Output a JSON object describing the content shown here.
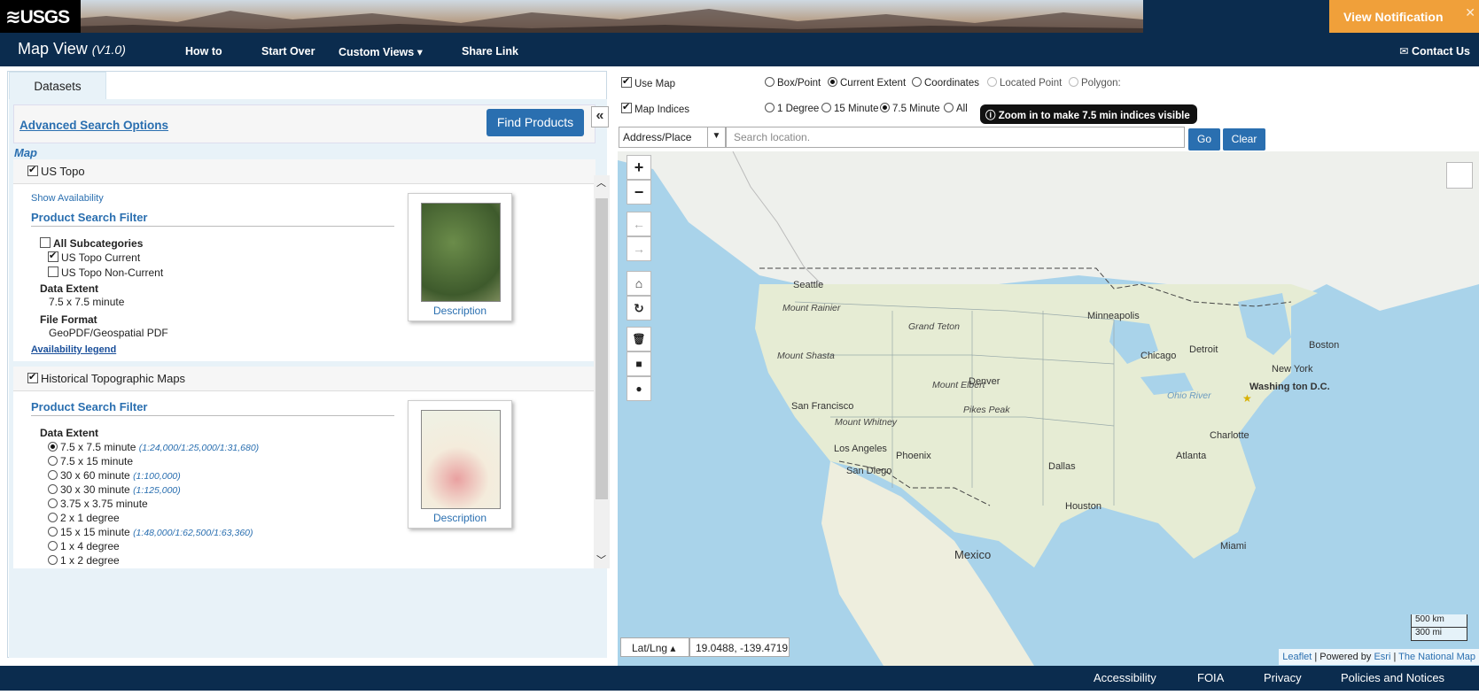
{
  "header": {
    "logo": "≋USGS",
    "notification": "View Notification",
    "close": "✕"
  },
  "nav": {
    "app_title": "Map View",
    "version": "(V1.0)",
    "how_to": "How to",
    "start_over": "Start Over",
    "custom_views": "Custom Views ▾",
    "share_link": "Share Link",
    "contact": "✉ Contact Us"
  },
  "left": {
    "tab": "Datasets",
    "advanced": "Advanced Search Options",
    "find": "Find Products",
    "collapse": "«",
    "map_heading": "Map",
    "us_topo": {
      "title": "US Topo",
      "show_availability": "Show Availability",
      "filter_title": "Product Search Filter",
      "all_sub": "All Subcategories",
      "current": "US Topo Current",
      "noncurrent": "US Topo Non-Current",
      "extent_label": "Data Extent",
      "extent_value": "7.5 x 7.5 minute",
      "format_label": "File Format",
      "format_value": "GeoPDF/Geospatial PDF",
      "legend": "Availability legend",
      "description": "Description"
    },
    "historical": {
      "title": "Historical Topographic Maps",
      "filter_title": "Product Search Filter",
      "extent_label": "Data Extent",
      "description": "Description",
      "options": [
        {
          "label": "7.5 x 7.5 minute",
          "scale": "(1:24,000/1:25,000/1:31,680)"
        },
        {
          "label": "7.5 x 15 minute",
          "scale": ""
        },
        {
          "label": "30 x 60 minute",
          "scale": "(1:100,000)"
        },
        {
          "label": "30 x 30 minute",
          "scale": "(1:125,000)"
        },
        {
          "label": "3.75 x 3.75 minute",
          "scale": ""
        },
        {
          "label": "2 x 1 degree",
          "scale": ""
        },
        {
          "label": "15 x 15 minute",
          "scale": "(1:48,000/1:62,500/1:63,360)"
        },
        {
          "label": "1 x 4 degree",
          "scale": ""
        },
        {
          "label": "1 x 2 degree",
          "scale": ""
        }
      ]
    }
  },
  "right": {
    "use_map": "Use Map",
    "box_point": "Box/Point",
    "current_extent": "Current Extent",
    "coordinates": "Coordinates",
    "located_point": "Located Point",
    "polygon": "Polygon:",
    "map_indices": "Map Indices",
    "one_degree": "1 Degree",
    "fifteen_min": "15 Minute",
    "seven_five": "7.5 Minute",
    "all": "All",
    "zoom_note": "Zoom in to make 7.5 min indices visible",
    "address": "Address/Place",
    "search_placeholder": "Search location.",
    "go": "Go",
    "clear": "Clear"
  },
  "map": {
    "latlng_mode": "Lat/Lng ▴",
    "coords": "19.0488, -139.4719",
    "scale_km": "500 km",
    "scale_mi": "300 mi",
    "attr_leaflet": "Leaflet",
    "attr_mid": " | Powered by ",
    "attr_esri": "Esri",
    "attr_sep": " | ",
    "attr_tnm": "The National Map",
    "labels": {
      "seattle": "Seattle",
      "rainier": "Mount Rainier",
      "shasta": "Mount Shasta",
      "sf": "San Francisco",
      "whitney": "Mount Whitney",
      "la": "Los Angeles",
      "sd": "San Diego",
      "phoenix": "Phoenix",
      "teton": "Grand Teton",
      "elbert": "Mount Elbert",
      "denver": "Denver",
      "pikes": "Pikes Peak",
      "minneapolis": "Minneapolis",
      "chicago": "Chicago",
      "detroit": "Detroit",
      "ny": "New York",
      "boston": "Boston",
      "dc": "Washing ton D.C.",
      "ohio": "Ohio River",
      "charlotte": "Charlotte",
      "atlanta": "Atlanta",
      "dallas": "Dallas",
      "houston": "Houston",
      "miami": "Miami",
      "mexico": "Mexico"
    }
  },
  "footer": {
    "accessibility": "Accessibility",
    "foia": "FOIA",
    "privacy": "Privacy",
    "policies": "Policies and Notices"
  }
}
